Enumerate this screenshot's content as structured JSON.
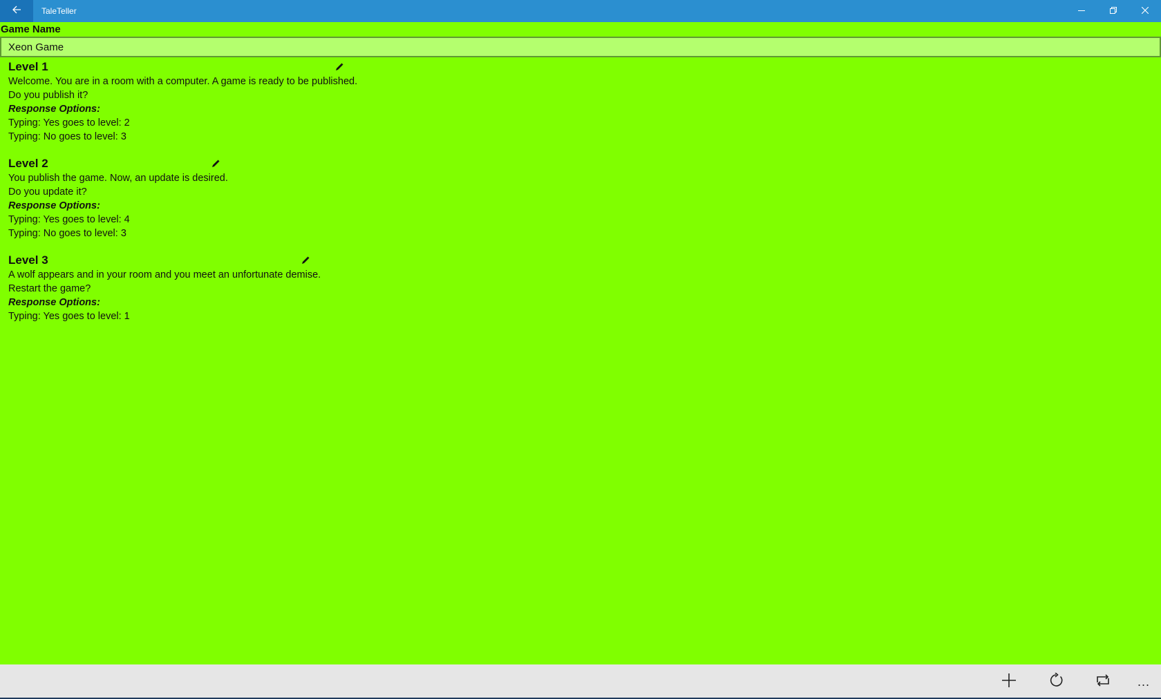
{
  "app": {
    "title": "TaleTeller"
  },
  "game": {
    "name_label": "Game Name",
    "name_value": "Xeon Game"
  },
  "levels": [
    {
      "title": "Level 1",
      "text": "Welcome. You are in a room with a computer. A game is ready to be published.",
      "question": "Do you publish it?",
      "response_label": "Response Options:",
      "options": [
        "Typing: Yes goes to level: 2",
        "Typing: No goes to level: 3"
      ]
    },
    {
      "title": "Level 2",
      "text": "You publish the game. Now, an update is desired.",
      "question": "Do you update it?",
      "response_label": "Response Options:",
      "options": [
        "Typing: Yes goes to level: 4",
        "Typing: No goes to level: 3"
      ]
    },
    {
      "title": "Level 3",
      "text": "A wolf appears and in your room and you meet an unfortunate demise.",
      "question": "Restart the game?",
      "response_label": "Response Options:",
      "options": [
        "Typing: Yes goes to level: 1"
      ]
    }
  ],
  "appbar": {
    "buttons": [
      "add-icon",
      "refresh-icon",
      "repeat-icon"
    ],
    "more": "..."
  },
  "colors": {
    "titlebar": "#2b8fd0",
    "background": "#80ff00",
    "input_background": "#b4ff6e",
    "appbar": "#e6e6e6"
  }
}
